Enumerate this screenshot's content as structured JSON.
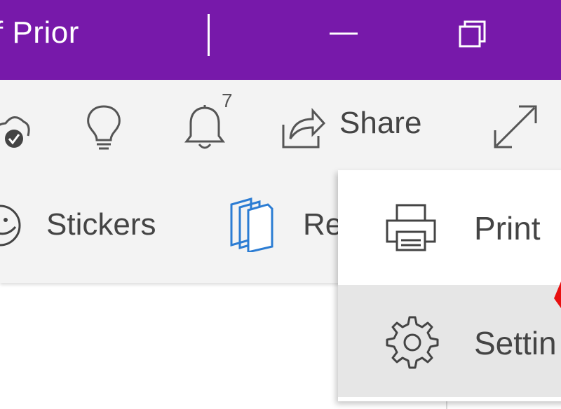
{
  "titlebar": {
    "title": "f Prior",
    "background": "#7719aa"
  },
  "toolbar": {
    "icons": [
      "cloud-sync-icon",
      "lightbulb-icon",
      "bell-icon",
      "share-icon",
      "fullscreen-icon"
    ],
    "notification_count": "7",
    "share_label": "Share"
  },
  "ribbon": {
    "stickers_label": "Stickers",
    "re_label": "Re"
  },
  "menu": {
    "items": [
      {
        "label": "Print",
        "icon": "printer-icon"
      },
      {
        "label": "Settin",
        "icon": "gear-icon"
      }
    ]
  },
  "colors": {
    "accent": "#7719aa",
    "ribbon_bg": "#f3f3f3",
    "selected_item": "#e6e6e6",
    "icon_blue": "#2b7cd3",
    "annotation_red": "#e81010"
  }
}
